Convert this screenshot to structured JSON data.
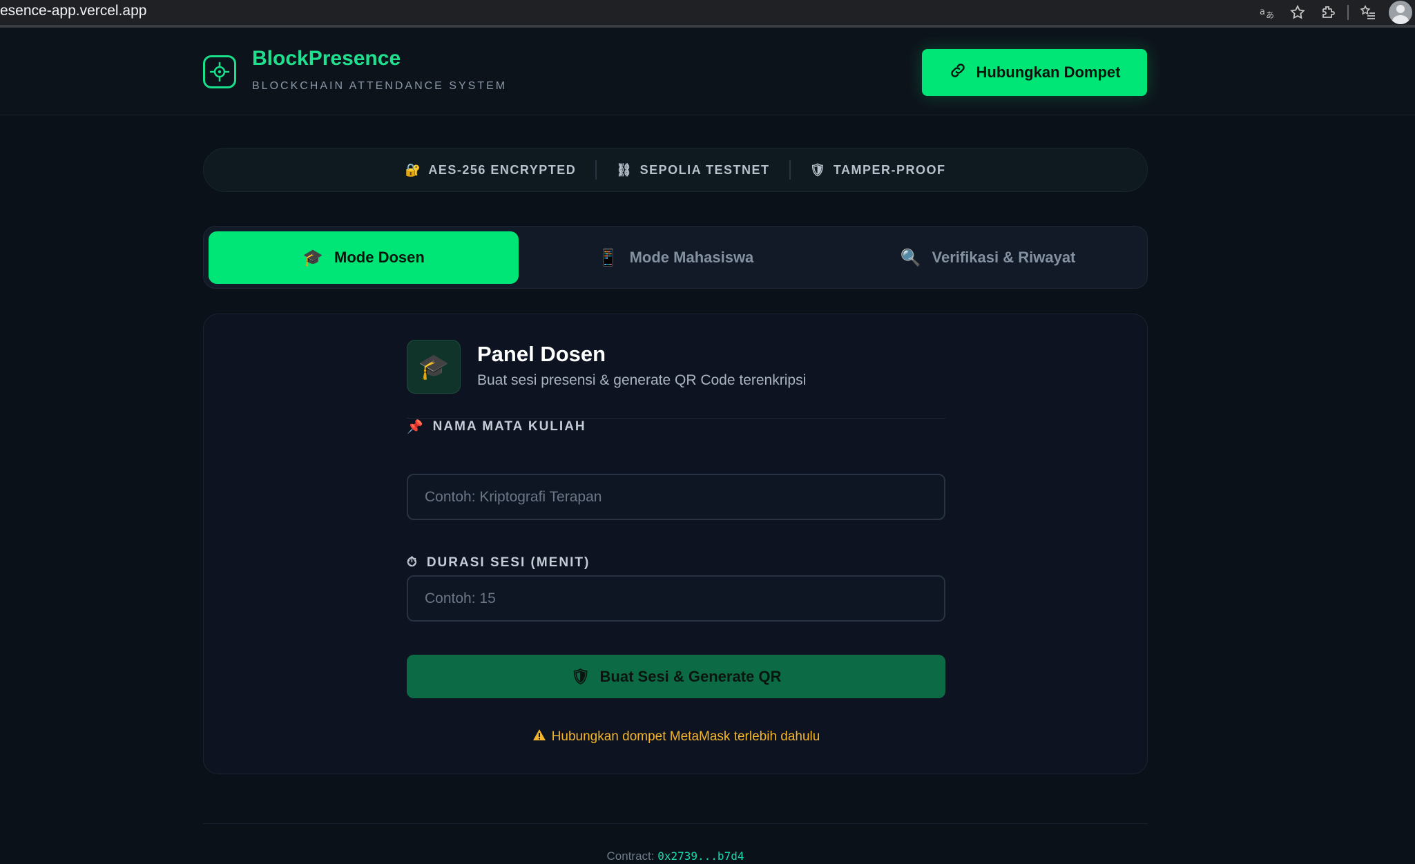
{
  "browser": {
    "url": "esence-app.vercel.app",
    "icons": [
      "translate-icon",
      "bookmark-star-icon",
      "extensions-icon",
      "reading-list-icon",
      "profile-avatar"
    ]
  },
  "header": {
    "brand_title": "BlockPresence",
    "brand_subtitle": "BLOCKCHAIN ATTENDANCE SYSTEM",
    "connect_label": "Hubungkan Dompet"
  },
  "security": {
    "items": [
      {
        "icon": "🔐",
        "label": "AES-256 ENCRYPTED"
      },
      {
        "icon": "⛓",
        "label": "SEPOLIA TESTNET"
      },
      {
        "icon": "🛡",
        "label": "TAMPER-PROOF"
      }
    ]
  },
  "tabs": [
    {
      "icon": "🎓",
      "label": "Mode Dosen",
      "active": true
    },
    {
      "icon": "📱",
      "label": "Mode Mahasiswa",
      "active": false
    },
    {
      "icon": "🔍",
      "label": "Verifikasi & Riwayat",
      "active": false
    }
  ],
  "panel": {
    "icon": "🎓",
    "title": "Panel Dosen",
    "subtitle": "Buat sesi presensi & generate QR Code terenkripsi",
    "course_label": "NAMA MATA KULIAH",
    "course_icon": "📌",
    "course_placeholder": "Contoh: Kriptografi Terapan",
    "course_value": "",
    "duration_label": "DURASI SESI (MENIT)",
    "duration_icon": "⏱",
    "duration_placeholder": "Contoh: 15",
    "duration_value": "",
    "submit_icon": "🛡",
    "submit_label": "Buat Sesi & Generate QR",
    "warning": "Hubungkan dompet MetaMask terlebih dahulu"
  },
  "footer": {
    "contract_label": "Contract:",
    "contract_address": "0x2739...b7d4"
  },
  "colors": {
    "accent": "#00e676",
    "brand": "#1fe08e",
    "background": "#0b1119",
    "warning": "#f5b52a",
    "address": "#19d9b0"
  }
}
